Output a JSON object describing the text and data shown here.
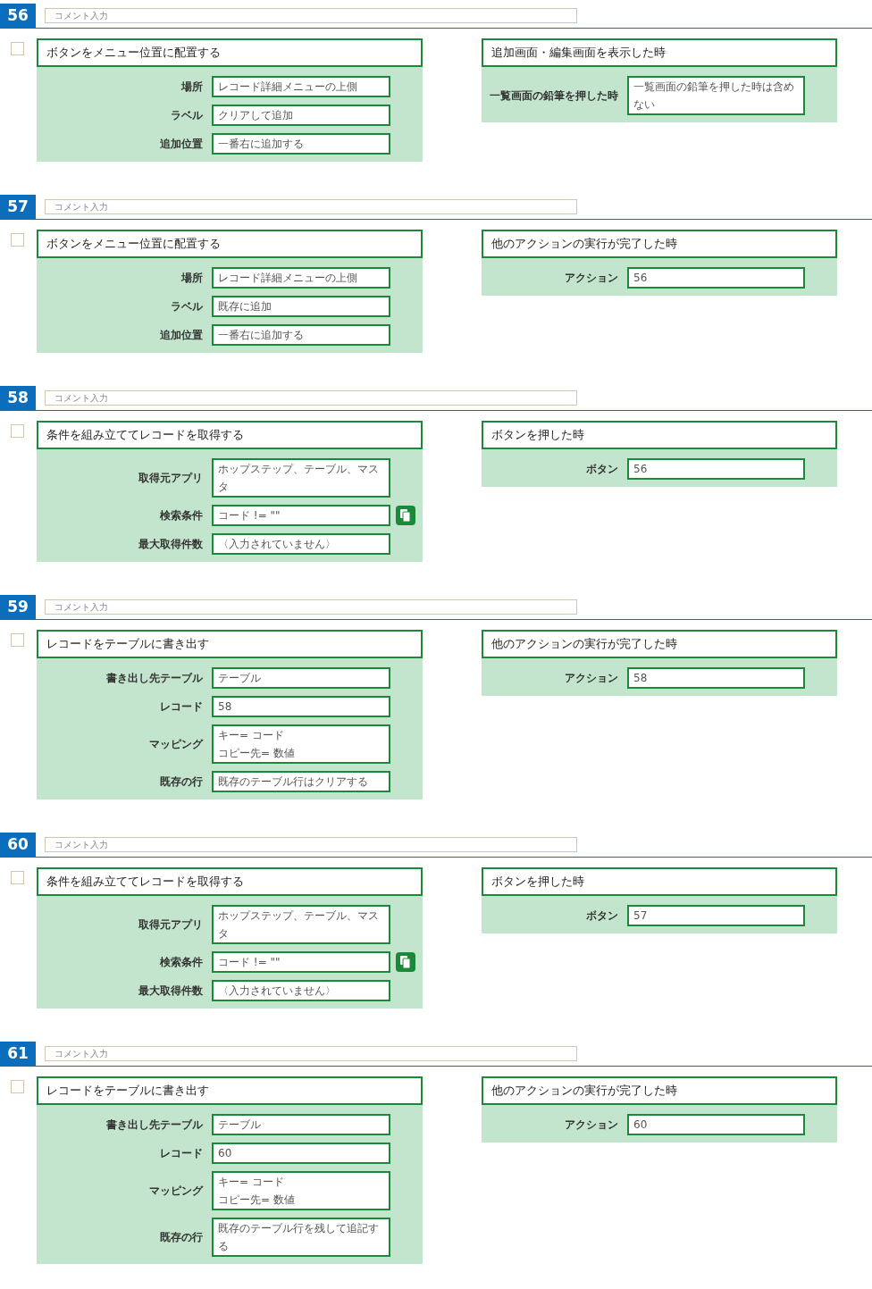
{
  "blocks": [
    {
      "number": "56",
      "comment_placeholder": "コメント入力",
      "checked": false,
      "action": {
        "title": "ボタンをメニュー位置に配置する",
        "fields": [
          {
            "label": "場所",
            "value": "レコード詳細メニューの上側",
            "copy_button": false
          },
          {
            "label": "ラベル",
            "value": "クリアして追加",
            "copy_button": false
          },
          {
            "label": "追加位置",
            "value": "一番右に追加する",
            "copy_button": false
          }
        ]
      },
      "trigger": {
        "title": "追加画面・編集画面を表示した時",
        "fields": [
          {
            "label": "一覧画面の鉛筆を押した時",
            "value": "一覧画面の鉛筆を押した時は含めない"
          }
        ]
      }
    },
    {
      "number": "57",
      "comment_placeholder": "コメント入力",
      "checked": false,
      "action": {
        "title": "ボタンをメニュー位置に配置する",
        "fields": [
          {
            "label": "場所",
            "value": "レコード詳細メニューの上側",
            "copy_button": false
          },
          {
            "label": "ラベル",
            "value": "既存に追加",
            "copy_button": false
          },
          {
            "label": "追加位置",
            "value": "一番右に追加する",
            "copy_button": false
          }
        ]
      },
      "trigger": {
        "title": "他のアクションの実行が完了した時",
        "fields": [
          {
            "label": "アクション",
            "value": "56"
          }
        ]
      }
    },
    {
      "number": "58",
      "comment_placeholder": "コメント入力",
      "checked": false,
      "action": {
        "title": "条件を組み立ててレコードを取得する",
        "fields": [
          {
            "label": "取得元アプリ",
            "value": "ホップステップ、テーブル、マスタ",
            "copy_button": false
          },
          {
            "label": "検索条件",
            "value": "コード != \"\"",
            "copy_button": true
          },
          {
            "label": "最大取得件数",
            "value": "〈入力されていません〉",
            "copy_button": false
          }
        ]
      },
      "trigger": {
        "title": "ボタンを押した時",
        "fields": [
          {
            "label": "ボタン",
            "value": "56"
          }
        ]
      }
    },
    {
      "number": "59",
      "comment_placeholder": "コメント入力",
      "checked": false,
      "action": {
        "title": "レコードをテーブルに書き出す",
        "fields": [
          {
            "label": "書き出し先テーブル",
            "value": "テーブル",
            "copy_button": false
          },
          {
            "label": "レコード",
            "value": "58",
            "copy_button": false
          },
          {
            "label": "マッピング",
            "lines": [
              "キー= コード",
              "コピー先= 数値"
            ],
            "copy_button": false
          },
          {
            "label": "既存の行",
            "value": "既存のテーブル行はクリアする",
            "copy_button": false
          }
        ]
      },
      "trigger": {
        "title": "他のアクションの実行が完了した時",
        "fields": [
          {
            "label": "アクション",
            "value": "58"
          }
        ]
      }
    },
    {
      "number": "60",
      "comment_placeholder": "コメント入力",
      "checked": false,
      "action": {
        "title": "条件を組み立ててレコードを取得する",
        "fields": [
          {
            "label": "取得元アプリ",
            "value": "ホップステップ、テーブル、マスタ",
            "copy_button": false
          },
          {
            "label": "検索条件",
            "value": "コード != \"\"",
            "copy_button": true
          },
          {
            "label": "最大取得件数",
            "value": "〈入力されていません〉",
            "copy_button": false
          }
        ]
      },
      "trigger": {
        "title": "ボタンを押した時",
        "fields": [
          {
            "label": "ボタン",
            "value": "57"
          }
        ]
      }
    },
    {
      "number": "61",
      "comment_placeholder": "コメント入力",
      "checked": false,
      "action": {
        "title": "レコードをテーブルに書き出す",
        "fields": [
          {
            "label": "書き出し先テーブル",
            "value": "テーブル",
            "copy_button": false
          },
          {
            "label": "レコード",
            "value": "60",
            "copy_button": false
          },
          {
            "label": "マッピング",
            "lines": [
              "キー= コード",
              "コピー先= 数値"
            ],
            "copy_button": false
          },
          {
            "label": "既存の行",
            "value": "既存のテーブル行を残して追記する",
            "copy_button": false
          }
        ]
      },
      "trigger": {
        "title": "他のアクションの実行が完了した時",
        "fields": [
          {
            "label": "アクション",
            "value": "60"
          }
        ]
      }
    }
  ]
}
